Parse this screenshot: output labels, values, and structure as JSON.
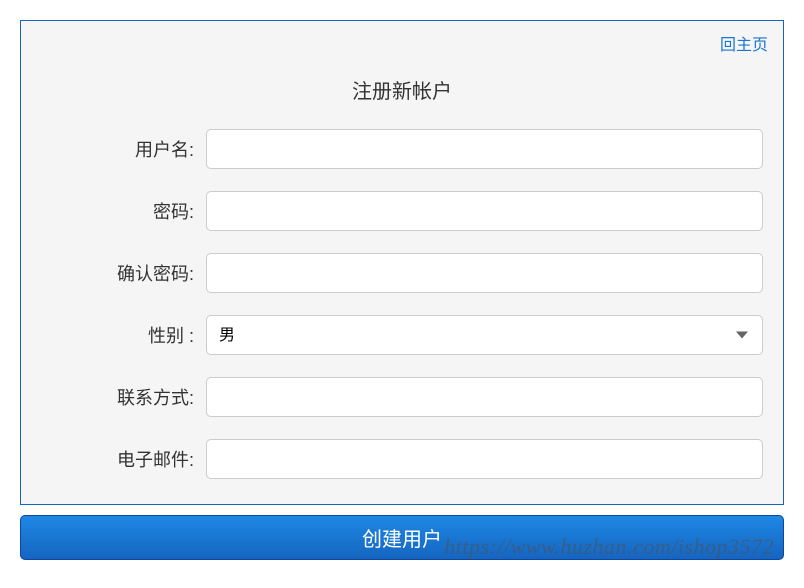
{
  "header": {
    "back_link": "回主页",
    "title": "注册新帐户"
  },
  "form": {
    "username_label": "用户名:",
    "password_label": "密码:",
    "confirm_password_label": "确认密码:",
    "gender_label": "性别 :",
    "gender_value": "男",
    "contact_label": "联系方式:",
    "email_label": "电子邮件:"
  },
  "submit": {
    "label": "创建用户"
  },
  "watermark": "https://www.huzhan.com/ishop3572"
}
